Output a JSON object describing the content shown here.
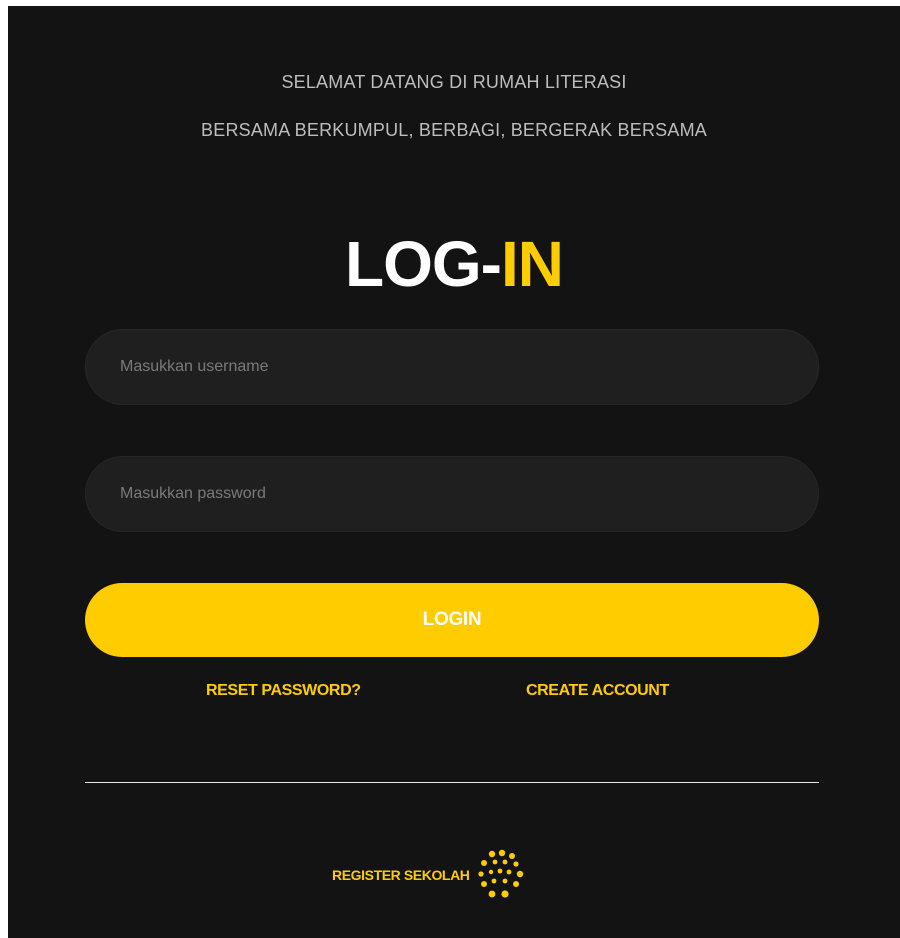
{
  "header": {
    "welcome_line1": "SELAMAT DATANG DI RUMAH LITERASI",
    "welcome_line2": "BERSAMA BERKUMPUL, BERBAGI, BERGERAK BERSAMA"
  },
  "title": {
    "part1": "LOG-",
    "part2": "IN"
  },
  "form": {
    "username_placeholder": "Masukkan username",
    "password_placeholder": "Masukkan password",
    "login_label": "LOGIN"
  },
  "links": {
    "reset": "RESET PASSWORD?",
    "create": "CREATE ACCOUNT"
  },
  "footer": {
    "register_label": "REGISTER SEKOLAH",
    "register_icon": "dot-cluster-icon"
  },
  "colors": {
    "background": "#131313",
    "accent": "#ffcc00",
    "field": "#1f1f1f"
  }
}
